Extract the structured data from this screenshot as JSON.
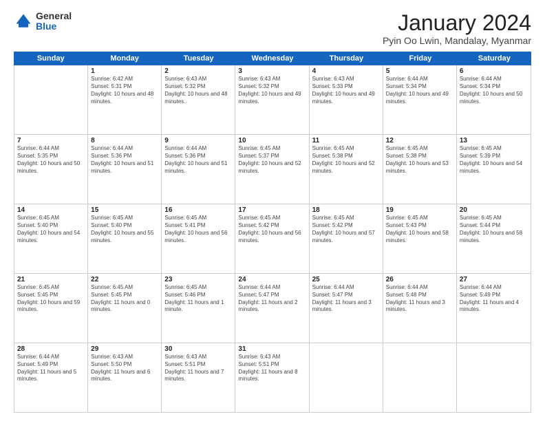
{
  "logo": {
    "general": "General",
    "blue": "Blue"
  },
  "header": {
    "month": "January 2024",
    "location": "Pyin Oo Lwin, Mandalay, Myanmar"
  },
  "days": [
    "Sunday",
    "Monday",
    "Tuesday",
    "Wednesday",
    "Thursday",
    "Friday",
    "Saturday"
  ],
  "weeks": [
    [
      {
        "day": "",
        "sunrise": "",
        "sunset": "",
        "daylight": ""
      },
      {
        "day": "1",
        "sunrise": "Sunrise: 6:42 AM",
        "sunset": "Sunset: 5:31 PM",
        "daylight": "Daylight: 10 hours and 48 minutes."
      },
      {
        "day": "2",
        "sunrise": "Sunrise: 6:43 AM",
        "sunset": "Sunset: 5:32 PM",
        "daylight": "Daylight: 10 hours and 48 minutes."
      },
      {
        "day": "3",
        "sunrise": "Sunrise: 6:43 AM",
        "sunset": "Sunset: 5:32 PM",
        "daylight": "Daylight: 10 hours and 49 minutes."
      },
      {
        "day": "4",
        "sunrise": "Sunrise: 6:43 AM",
        "sunset": "Sunset: 5:33 PM",
        "daylight": "Daylight: 10 hours and 49 minutes."
      },
      {
        "day": "5",
        "sunrise": "Sunrise: 6:44 AM",
        "sunset": "Sunset: 5:34 PM",
        "daylight": "Daylight: 10 hours and 49 minutes."
      },
      {
        "day": "6",
        "sunrise": "Sunrise: 6:44 AM",
        "sunset": "Sunset: 5:34 PM",
        "daylight": "Daylight: 10 hours and 50 minutes."
      }
    ],
    [
      {
        "day": "7",
        "sunrise": "Sunrise: 6:44 AM",
        "sunset": "Sunset: 5:35 PM",
        "daylight": "Daylight: 10 hours and 50 minutes."
      },
      {
        "day": "8",
        "sunrise": "Sunrise: 6:44 AM",
        "sunset": "Sunset: 5:36 PM",
        "daylight": "Daylight: 10 hours and 51 minutes."
      },
      {
        "day": "9",
        "sunrise": "Sunrise: 6:44 AM",
        "sunset": "Sunset: 5:36 PM",
        "daylight": "Daylight: 10 hours and 51 minutes."
      },
      {
        "day": "10",
        "sunrise": "Sunrise: 6:45 AM",
        "sunset": "Sunset: 5:37 PM",
        "daylight": "Daylight: 10 hours and 52 minutes."
      },
      {
        "day": "11",
        "sunrise": "Sunrise: 6:45 AM",
        "sunset": "Sunset: 5:38 PM",
        "daylight": "Daylight: 10 hours and 52 minutes."
      },
      {
        "day": "12",
        "sunrise": "Sunrise: 6:45 AM",
        "sunset": "Sunset: 5:38 PM",
        "daylight": "Daylight: 10 hours and 53 minutes."
      },
      {
        "day": "13",
        "sunrise": "Sunrise: 6:45 AM",
        "sunset": "Sunset: 5:39 PM",
        "daylight": "Daylight: 10 hours and 54 minutes."
      }
    ],
    [
      {
        "day": "14",
        "sunrise": "Sunrise: 6:45 AM",
        "sunset": "Sunset: 5:40 PM",
        "daylight": "Daylight: 10 hours and 54 minutes."
      },
      {
        "day": "15",
        "sunrise": "Sunrise: 6:45 AM",
        "sunset": "Sunset: 5:40 PM",
        "daylight": "Daylight: 10 hours and 55 minutes."
      },
      {
        "day": "16",
        "sunrise": "Sunrise: 6:45 AM",
        "sunset": "Sunset: 5:41 PM",
        "daylight": "Daylight: 10 hours and 56 minutes."
      },
      {
        "day": "17",
        "sunrise": "Sunrise: 6:45 AM",
        "sunset": "Sunset: 5:42 PM",
        "daylight": "Daylight: 10 hours and 56 minutes."
      },
      {
        "day": "18",
        "sunrise": "Sunrise: 6:45 AM",
        "sunset": "Sunset: 5:42 PM",
        "daylight": "Daylight: 10 hours and 57 minutes."
      },
      {
        "day": "19",
        "sunrise": "Sunrise: 6:45 AM",
        "sunset": "Sunset: 5:43 PM",
        "daylight": "Daylight: 10 hours and 58 minutes."
      },
      {
        "day": "20",
        "sunrise": "Sunrise: 6:45 AM",
        "sunset": "Sunset: 5:44 PM",
        "daylight": "Daylight: 10 hours and 58 minutes."
      }
    ],
    [
      {
        "day": "21",
        "sunrise": "Sunrise: 6:45 AM",
        "sunset": "Sunset: 5:45 PM",
        "daylight": "Daylight: 10 hours and 59 minutes."
      },
      {
        "day": "22",
        "sunrise": "Sunrise: 6:45 AM",
        "sunset": "Sunset: 5:45 PM",
        "daylight": "Daylight: 11 hours and 0 minutes."
      },
      {
        "day": "23",
        "sunrise": "Sunrise: 6:45 AM",
        "sunset": "Sunset: 5:46 PM",
        "daylight": "Daylight: 11 hours and 1 minute."
      },
      {
        "day": "24",
        "sunrise": "Sunrise: 6:44 AM",
        "sunset": "Sunset: 5:47 PM",
        "daylight": "Daylight: 11 hours and 2 minutes."
      },
      {
        "day": "25",
        "sunrise": "Sunrise: 6:44 AM",
        "sunset": "Sunset: 5:47 PM",
        "daylight": "Daylight: 11 hours and 3 minutes."
      },
      {
        "day": "26",
        "sunrise": "Sunrise: 6:44 AM",
        "sunset": "Sunset: 5:48 PM",
        "daylight": "Daylight: 11 hours and 3 minutes."
      },
      {
        "day": "27",
        "sunrise": "Sunrise: 6:44 AM",
        "sunset": "Sunset: 5:49 PM",
        "daylight": "Daylight: 11 hours and 4 minutes."
      }
    ],
    [
      {
        "day": "28",
        "sunrise": "Sunrise: 6:44 AM",
        "sunset": "Sunset: 5:49 PM",
        "daylight": "Daylight: 11 hours and 5 minutes."
      },
      {
        "day": "29",
        "sunrise": "Sunrise: 6:43 AM",
        "sunset": "Sunset: 5:50 PM",
        "daylight": "Daylight: 11 hours and 6 minutes."
      },
      {
        "day": "30",
        "sunrise": "Sunrise: 6:43 AM",
        "sunset": "Sunset: 5:51 PM",
        "daylight": "Daylight: 11 hours and 7 minutes."
      },
      {
        "day": "31",
        "sunrise": "Sunrise: 6:43 AM",
        "sunset": "Sunset: 5:51 PM",
        "daylight": "Daylight: 11 hours and 8 minutes."
      },
      {
        "day": "",
        "sunrise": "",
        "sunset": "",
        "daylight": ""
      },
      {
        "day": "",
        "sunrise": "",
        "sunset": "",
        "daylight": ""
      },
      {
        "day": "",
        "sunrise": "",
        "sunset": "",
        "daylight": ""
      }
    ]
  ]
}
